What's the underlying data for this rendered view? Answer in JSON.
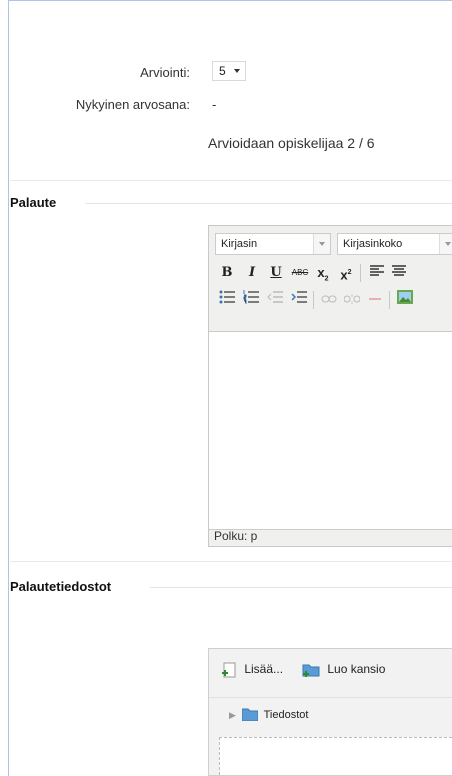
{
  "grading": {
    "label": "Arviointi:",
    "value": "5",
    "current_grade_label": "Nykyinen arvosana:",
    "current_grade_value": "-",
    "progress_text": "Arvioidaan opiskelijaa 2 / 6"
  },
  "feedback": {
    "legend": "Palaute",
    "font_combo": "Kirjasin",
    "size_combo": "Kirjasinkoko",
    "path_label": "Polku: p"
  },
  "feedback_files": {
    "legend": "Palautetiedostot",
    "add_label": "Lisää...",
    "create_folder_label": "Luo kansio",
    "folder_label": "Tiedostot"
  }
}
